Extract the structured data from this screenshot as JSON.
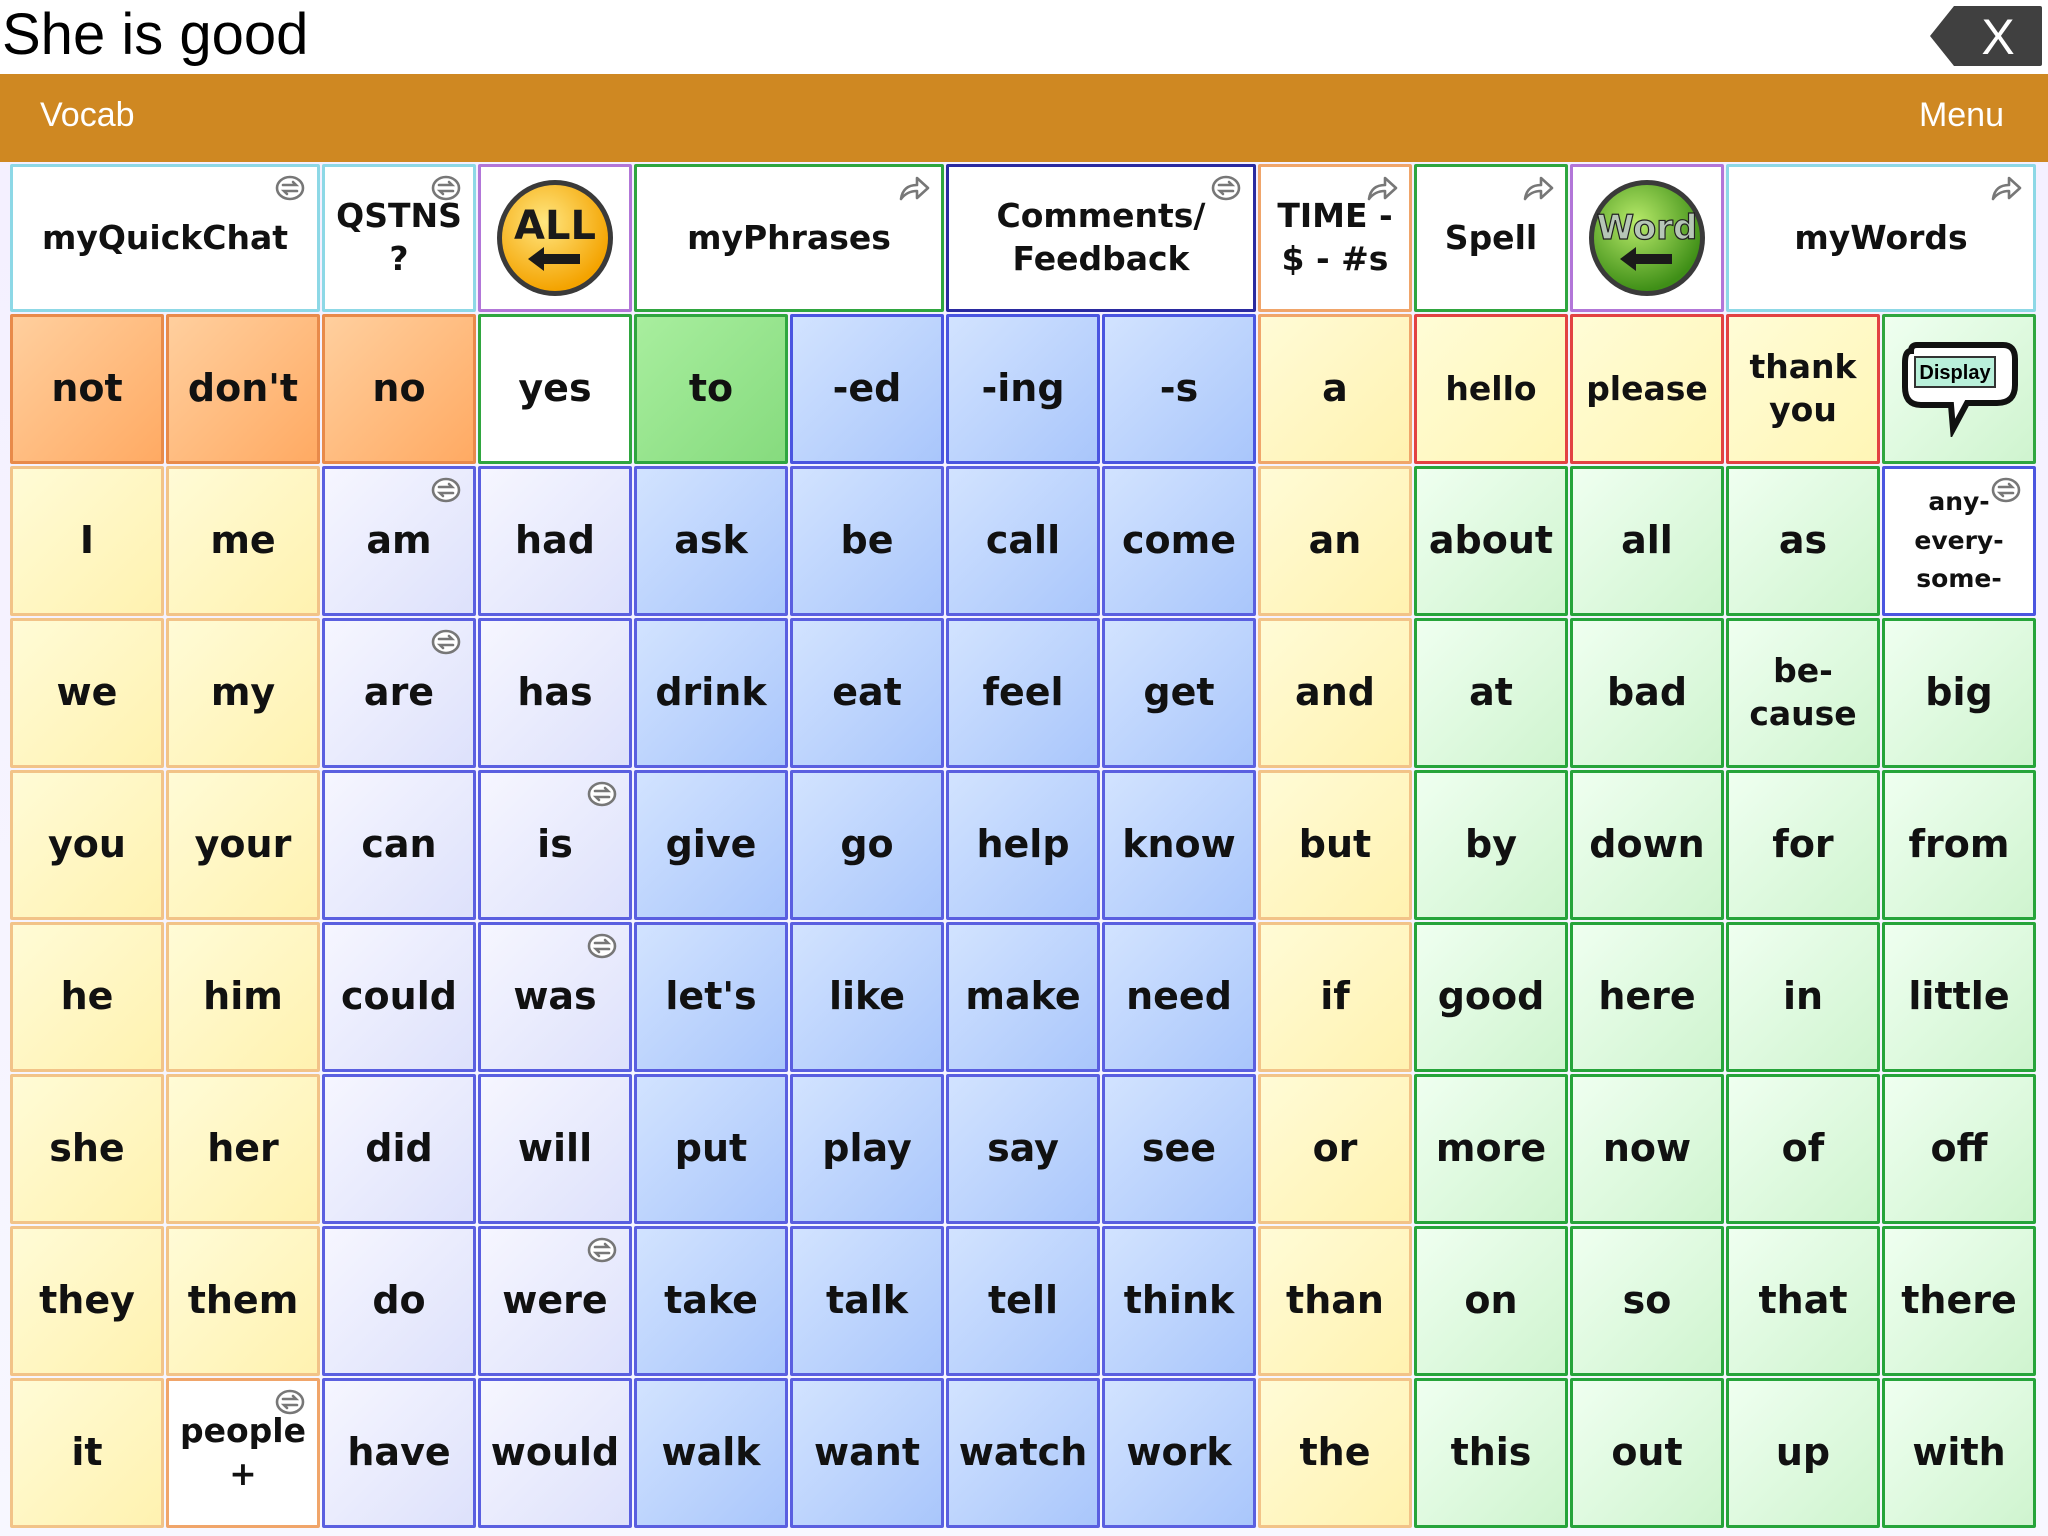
{
  "message_bar": {
    "text": "She is good"
  },
  "nav": {
    "vocab": "Vocab",
    "menu": "Menu"
  },
  "buttons": {
    "clear": "X",
    "all_button": "ALL",
    "word_button": "Word",
    "display_button": "Display"
  },
  "colors": {
    "nav_bar": "#cf8822",
    "orange": "#ffaa63",
    "yellow": "#fff2b0",
    "lavender": "#dde1fb",
    "blue": "#a9c6fb",
    "light_green": "#cff4cf",
    "green": "#86db7e"
  },
  "icons": [
    "clear-message-icon",
    "all-arrow-icon",
    "word-arrow-icon",
    "speech-bubble-icon",
    "folder-link-icon",
    "jump-link-icon"
  ],
  "top_row": [
    {
      "label": "myQuickChat",
      "icon": "folder-link-icon"
    },
    {
      "label": "QSTNS\n?",
      "icon": "folder-link-icon"
    },
    {
      "label": "ALL",
      "icon": "all-arrow-icon"
    },
    {
      "label": "myPhrases",
      "icon": "jump-link-icon"
    },
    {
      "label": "Comments/\nFeedback",
      "icon": "folder-link-icon"
    },
    {
      "label": "TIME -\n$ - #s",
      "icon": "jump-link-icon"
    },
    {
      "label": "Spell",
      "icon": "jump-link-icon"
    },
    {
      "label": "Word",
      "icon": "word-arrow-icon"
    },
    {
      "label": "myWords",
      "icon": "jump-link-icon"
    }
  ],
  "rows": [
    [
      "not",
      "don't",
      "no",
      "yes",
      "to",
      "-ed",
      "-ing",
      "-s",
      "a",
      "hello",
      "please",
      "thank\nyou",
      "Display"
    ],
    [
      "I",
      "me",
      "am",
      "had",
      "ask",
      "be",
      "call",
      "come",
      "an",
      "about",
      "all",
      "as",
      "any-\nevery-\nsome-"
    ],
    [
      "we",
      "my",
      "are",
      "has",
      "drink",
      "eat",
      "feel",
      "get",
      "and",
      "at",
      "bad",
      "be-\ncause",
      "big"
    ],
    [
      "you",
      "your",
      "can",
      "is",
      "give",
      "go",
      "help",
      "know",
      "but",
      "by",
      "down",
      "for",
      "from"
    ],
    [
      "he",
      "him",
      "could",
      "was",
      "let's",
      "like",
      "make",
      "need",
      "if",
      "good",
      "here",
      "in",
      "little"
    ],
    [
      "she",
      "her",
      "did",
      "will",
      "put",
      "play",
      "say",
      "see",
      "or",
      "more",
      "now",
      "of",
      "off"
    ],
    [
      "they",
      "them",
      "do",
      "were",
      "take",
      "talk",
      "tell",
      "think",
      "than",
      "on",
      "so",
      "that",
      "there"
    ],
    [
      "it",
      "people\n+",
      "have",
      "would",
      "walk",
      "want",
      "watch",
      "work",
      "the",
      "this",
      "out",
      "up",
      "with"
    ]
  ]
}
